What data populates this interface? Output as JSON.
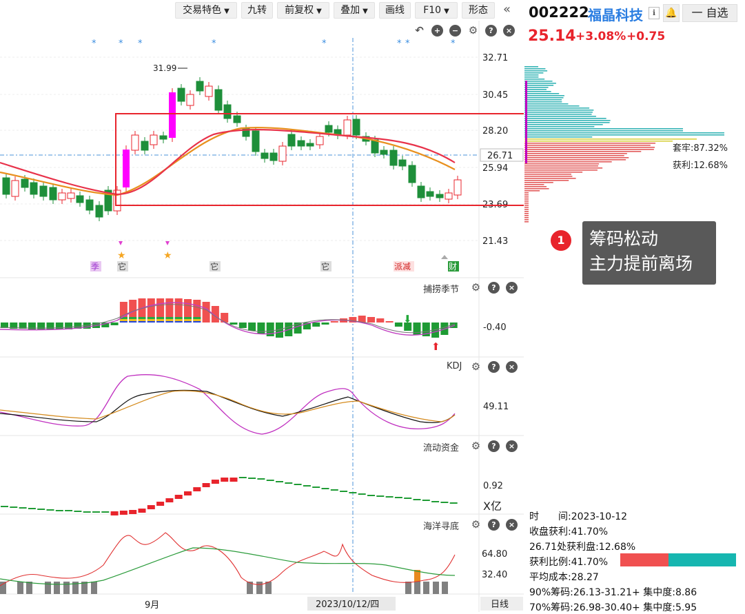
{
  "toolbar": {
    "buttons": [
      {
        "label": "交易特色",
        "dropdown": true
      },
      {
        "label": "九转",
        "dropdown": false
      },
      {
        "label": "前复权",
        "dropdown": true
      },
      {
        "label": "叠加",
        "dropdown": true
      },
      {
        "label": "画线",
        "dropdown": false
      },
      {
        "label": "F10",
        "dropdown": true
      },
      {
        "label": "形态",
        "dropdown": false
      }
    ],
    "collapse_icon": "double-chevron-left-icon"
  },
  "stock": {
    "code": "002222",
    "name": "福晶科技",
    "price": "25.14",
    "change_pct": "+3.08%",
    "change_abs": "+0.75",
    "watchlist_label": "一 自选",
    "up_color": "#e8242c",
    "name_color": "#2a7de1"
  },
  "kline": {
    "price_ticks": [
      "32.71",
      "30.45",
      "28.20",
      "25.94",
      "23.69",
      "21.43"
    ],
    "crosshair_price": "26.71",
    "high_marker": "31.99",
    "event_labels": [
      "季",
      "它",
      "它",
      "它",
      "派减",
      "财"
    ],
    "tool_icons": [
      "undo-icon",
      "zoom-in-icon",
      "zoom-out-icon",
      "gear-icon",
      "help-icon",
      "close-icon"
    ]
  },
  "chips": {
    "trapped_label": "套牢:87.32%",
    "profit_label": "获利:12.68%"
  },
  "annotation": {
    "badge": "1",
    "line1": "筹码松动",
    "line2": "主力提前离场"
  },
  "indicators": {
    "buhuo": {
      "title": "捕捞季节",
      "value": "-0.40"
    },
    "kdj": {
      "title": "KDJ",
      "value": "49.11"
    },
    "flow": {
      "title": "流动资金",
      "value": "0.92",
      "unit": "X亿"
    },
    "ocean": {
      "title": "海洋寻底",
      "values": [
        "64.80",
        "32.40"
      ]
    }
  },
  "xaxis": {
    "month_label": "9月",
    "cursor_date": "2023/10/12/四",
    "period_label": "日线"
  },
  "chip_info": {
    "time_label": "时　　间:2023-10-12",
    "close_profit": "收盘获利:41.70%",
    "at_price_profit": "26.71处获利盘:12.68%",
    "profit_ratio_label": "获利比例:41.70%",
    "avg_cost": "平均成本:28.27",
    "c90": "90%筹码:26.13-31.21+ 集中度:8.86",
    "c70": "70%筹码:26.98-30.40+ 集中度:5.95",
    "profit_ratio": 0.417
  }
}
